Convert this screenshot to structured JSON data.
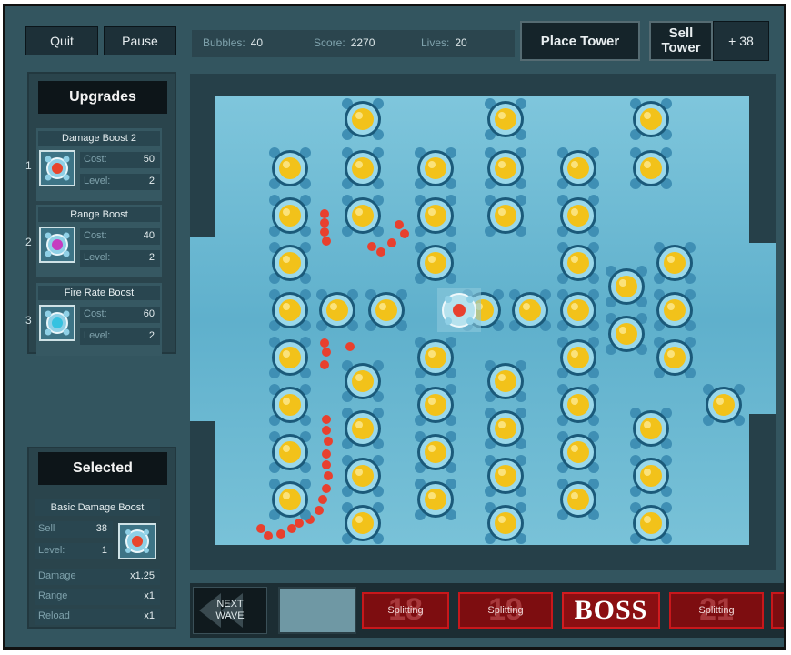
{
  "toolbar": {
    "quit_label": "Quit",
    "pause_label": "Pause",
    "place_tower_label": "Place Tower",
    "sell_tower_label": "Sell Tower",
    "sell_value": "+ 38"
  },
  "stats": {
    "bubbles_label": "Bubbles:",
    "bubbles_value": "40",
    "score_label": "Score:",
    "score_value": "2270",
    "lives_label": "Lives:",
    "lives_value": "20"
  },
  "upgrades": {
    "title": "Upgrades",
    "items": [
      {
        "number": "1",
        "name": "Damage Boost 2",
        "cost_label": "Cost:",
        "cost": "50",
        "level_label": "Level:",
        "level": "2",
        "icon": "damage-boost-icon",
        "color": "#e8452c"
      },
      {
        "number": "2",
        "name": "Range Boost",
        "cost_label": "Cost:",
        "cost": "40",
        "level_label": "Level:",
        "level": "2",
        "icon": "range-boost-icon",
        "color": "#c63cc0"
      },
      {
        "number": "3",
        "name": "Fire Rate Boost",
        "cost_label": "Cost:",
        "cost": "60",
        "level_label": "Level:",
        "level": "2",
        "icon": "fire-rate-boost-icon",
        "color": "#36c2e0"
      }
    ]
  },
  "selected": {
    "title": "Selected",
    "name": "Basic Damage Boost",
    "sell_label": "Sell",
    "sell_value": "38",
    "level_label": "Level:",
    "level_value": "1",
    "damage_label": "Damage",
    "damage_value": "x1.25",
    "range_label": "Range",
    "range_value": "x1",
    "reload_label": "Reload",
    "reload_value": "x1"
  },
  "waves": {
    "next_label": "NEXT WAVE",
    "items": [
      {
        "number": "18",
        "label": "Splitting"
      },
      {
        "number": "19",
        "label": "Splitting"
      },
      {
        "number": "",
        "label": "BOSS"
      },
      {
        "number": "21",
        "label": "Splitting"
      }
    ]
  },
  "colors": {
    "tower_ring": "#1b5a7a",
    "tower_core": "#f2c21a",
    "play_field": "#5fb0cc",
    "enemy": "#e8402e"
  }
}
